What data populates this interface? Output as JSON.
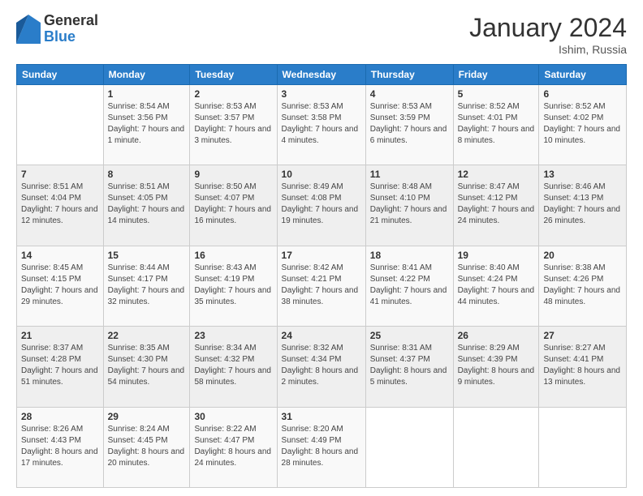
{
  "header": {
    "logo_general": "General",
    "logo_blue": "Blue",
    "month_title": "January 2024",
    "location": "Ishim, Russia"
  },
  "days_of_week": [
    "Sunday",
    "Monday",
    "Tuesday",
    "Wednesday",
    "Thursday",
    "Friday",
    "Saturday"
  ],
  "weeks": [
    [
      {
        "day": "",
        "sunrise": "",
        "sunset": "",
        "daylight": ""
      },
      {
        "day": "1",
        "sunrise": "Sunrise: 8:54 AM",
        "sunset": "Sunset: 3:56 PM",
        "daylight": "Daylight: 7 hours and 1 minute."
      },
      {
        "day": "2",
        "sunrise": "Sunrise: 8:53 AM",
        "sunset": "Sunset: 3:57 PM",
        "daylight": "Daylight: 7 hours and 3 minutes."
      },
      {
        "day": "3",
        "sunrise": "Sunrise: 8:53 AM",
        "sunset": "Sunset: 3:58 PM",
        "daylight": "Daylight: 7 hours and 4 minutes."
      },
      {
        "day": "4",
        "sunrise": "Sunrise: 8:53 AM",
        "sunset": "Sunset: 3:59 PM",
        "daylight": "Daylight: 7 hours and 6 minutes."
      },
      {
        "day": "5",
        "sunrise": "Sunrise: 8:52 AM",
        "sunset": "Sunset: 4:01 PM",
        "daylight": "Daylight: 7 hours and 8 minutes."
      },
      {
        "day": "6",
        "sunrise": "Sunrise: 8:52 AM",
        "sunset": "Sunset: 4:02 PM",
        "daylight": "Daylight: 7 hours and 10 minutes."
      }
    ],
    [
      {
        "day": "7",
        "sunrise": "Sunrise: 8:51 AM",
        "sunset": "Sunset: 4:04 PM",
        "daylight": "Daylight: 7 hours and 12 minutes."
      },
      {
        "day": "8",
        "sunrise": "Sunrise: 8:51 AM",
        "sunset": "Sunset: 4:05 PM",
        "daylight": "Daylight: 7 hours and 14 minutes."
      },
      {
        "day": "9",
        "sunrise": "Sunrise: 8:50 AM",
        "sunset": "Sunset: 4:07 PM",
        "daylight": "Daylight: 7 hours and 16 minutes."
      },
      {
        "day": "10",
        "sunrise": "Sunrise: 8:49 AM",
        "sunset": "Sunset: 4:08 PM",
        "daylight": "Daylight: 7 hours and 19 minutes."
      },
      {
        "day": "11",
        "sunrise": "Sunrise: 8:48 AM",
        "sunset": "Sunset: 4:10 PM",
        "daylight": "Daylight: 7 hours and 21 minutes."
      },
      {
        "day": "12",
        "sunrise": "Sunrise: 8:47 AM",
        "sunset": "Sunset: 4:12 PM",
        "daylight": "Daylight: 7 hours and 24 minutes."
      },
      {
        "day": "13",
        "sunrise": "Sunrise: 8:46 AM",
        "sunset": "Sunset: 4:13 PM",
        "daylight": "Daylight: 7 hours and 26 minutes."
      }
    ],
    [
      {
        "day": "14",
        "sunrise": "Sunrise: 8:45 AM",
        "sunset": "Sunset: 4:15 PM",
        "daylight": "Daylight: 7 hours and 29 minutes."
      },
      {
        "day": "15",
        "sunrise": "Sunrise: 8:44 AM",
        "sunset": "Sunset: 4:17 PM",
        "daylight": "Daylight: 7 hours and 32 minutes."
      },
      {
        "day": "16",
        "sunrise": "Sunrise: 8:43 AM",
        "sunset": "Sunset: 4:19 PM",
        "daylight": "Daylight: 7 hours and 35 minutes."
      },
      {
        "day": "17",
        "sunrise": "Sunrise: 8:42 AM",
        "sunset": "Sunset: 4:21 PM",
        "daylight": "Daylight: 7 hours and 38 minutes."
      },
      {
        "day": "18",
        "sunrise": "Sunrise: 8:41 AM",
        "sunset": "Sunset: 4:22 PM",
        "daylight": "Daylight: 7 hours and 41 minutes."
      },
      {
        "day": "19",
        "sunrise": "Sunrise: 8:40 AM",
        "sunset": "Sunset: 4:24 PM",
        "daylight": "Daylight: 7 hours and 44 minutes."
      },
      {
        "day": "20",
        "sunrise": "Sunrise: 8:38 AM",
        "sunset": "Sunset: 4:26 PM",
        "daylight": "Daylight: 7 hours and 48 minutes."
      }
    ],
    [
      {
        "day": "21",
        "sunrise": "Sunrise: 8:37 AM",
        "sunset": "Sunset: 4:28 PM",
        "daylight": "Daylight: 7 hours and 51 minutes."
      },
      {
        "day": "22",
        "sunrise": "Sunrise: 8:35 AM",
        "sunset": "Sunset: 4:30 PM",
        "daylight": "Daylight: 7 hours and 54 minutes."
      },
      {
        "day": "23",
        "sunrise": "Sunrise: 8:34 AM",
        "sunset": "Sunset: 4:32 PM",
        "daylight": "Daylight: 7 hours and 58 minutes."
      },
      {
        "day": "24",
        "sunrise": "Sunrise: 8:32 AM",
        "sunset": "Sunset: 4:34 PM",
        "daylight": "Daylight: 8 hours and 2 minutes."
      },
      {
        "day": "25",
        "sunrise": "Sunrise: 8:31 AM",
        "sunset": "Sunset: 4:37 PM",
        "daylight": "Daylight: 8 hours and 5 minutes."
      },
      {
        "day": "26",
        "sunrise": "Sunrise: 8:29 AM",
        "sunset": "Sunset: 4:39 PM",
        "daylight": "Daylight: 8 hours and 9 minutes."
      },
      {
        "day": "27",
        "sunrise": "Sunrise: 8:27 AM",
        "sunset": "Sunset: 4:41 PM",
        "daylight": "Daylight: 8 hours and 13 minutes."
      }
    ],
    [
      {
        "day": "28",
        "sunrise": "Sunrise: 8:26 AM",
        "sunset": "Sunset: 4:43 PM",
        "daylight": "Daylight: 8 hours and 17 minutes."
      },
      {
        "day": "29",
        "sunrise": "Sunrise: 8:24 AM",
        "sunset": "Sunset: 4:45 PM",
        "daylight": "Daylight: 8 hours and 20 minutes."
      },
      {
        "day": "30",
        "sunrise": "Sunrise: 8:22 AM",
        "sunset": "Sunset: 4:47 PM",
        "daylight": "Daylight: 8 hours and 24 minutes."
      },
      {
        "day": "31",
        "sunrise": "Sunrise: 8:20 AM",
        "sunset": "Sunset: 4:49 PM",
        "daylight": "Daylight: 8 hours and 28 minutes."
      },
      {
        "day": "",
        "sunrise": "",
        "sunset": "",
        "daylight": ""
      },
      {
        "day": "",
        "sunrise": "",
        "sunset": "",
        "daylight": ""
      },
      {
        "day": "",
        "sunrise": "",
        "sunset": "",
        "daylight": ""
      }
    ]
  ]
}
